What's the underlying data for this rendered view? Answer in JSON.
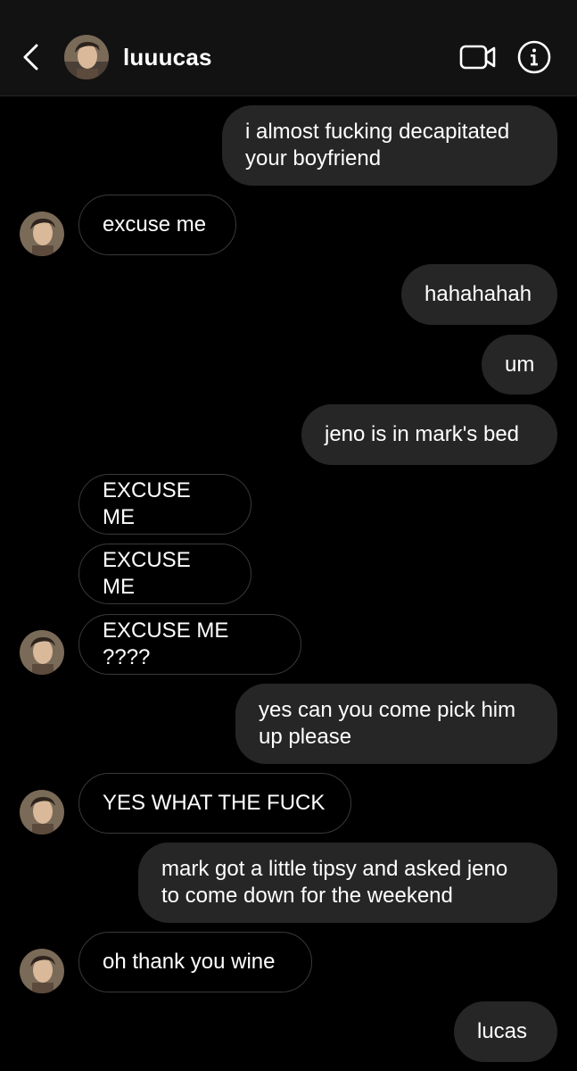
{
  "header": {
    "username": "luuucas",
    "back_icon": "chevron-left-icon",
    "video_icon": "video-camera-icon",
    "info_icon": "info-icon"
  },
  "messages": [
    {
      "from": "me",
      "text": "i almost fucking decapitated\nyour boyfriend"
    },
    {
      "from": "them",
      "text": "excuse me"
    },
    {
      "from": "me",
      "text": "hahahahah"
    },
    {
      "from": "me",
      "text": "um"
    },
    {
      "from": "me",
      "text": "jeno is in mark's bed"
    },
    {
      "from": "them",
      "text": "EXCUSE ME"
    },
    {
      "from": "them",
      "text": "EXCUSE ME"
    },
    {
      "from": "them",
      "text": "EXCUSE ME ????"
    },
    {
      "from": "me",
      "text": "yes can you come pick him\nup please"
    },
    {
      "from": "them",
      "text": "YES WHAT THE FUCK"
    },
    {
      "from": "me",
      "text": "mark got a little tipsy and asked jeno\nto come down for the weekend"
    },
    {
      "from": "them",
      "text": "oh thank you wine"
    },
    {
      "from": "me",
      "text": "lucas"
    }
  ],
  "colors": {
    "header_bg": "#121212",
    "sent_bubble_bg": "#262626",
    "received_bubble_border": "#3a3a3a",
    "background": "#000000"
  }
}
